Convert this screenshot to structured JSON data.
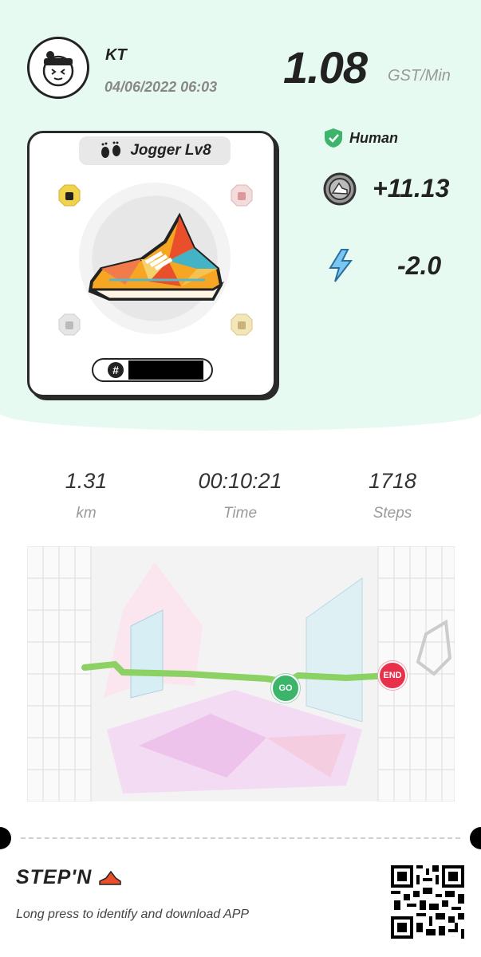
{
  "user": {
    "name": "KT",
    "datetime": "04/06/2022 06:03"
  },
  "rate": {
    "value": "1.08",
    "unit": "GST/Min"
  },
  "sneaker": {
    "type_level": "Jogger Lv8",
    "id_prefix": "#"
  },
  "badges": {
    "human_label": "Human",
    "gst_earned": "+11.13",
    "energy": "-2.0"
  },
  "stats": [
    {
      "value": "1.31",
      "label": "km"
    },
    {
      "value": "00:10:21",
      "label": "Time"
    },
    {
      "value": "1718",
      "label": "Steps"
    }
  ],
  "map": {
    "start_label": "GO",
    "end_label": "END"
  },
  "footer": {
    "brand": "STEP'N",
    "text": "Long press to identify and download APP"
  },
  "colors": {
    "background_top": "#e7faf1",
    "route": "#8bd163",
    "go": "#3cb56b",
    "end": "#e8304a"
  }
}
